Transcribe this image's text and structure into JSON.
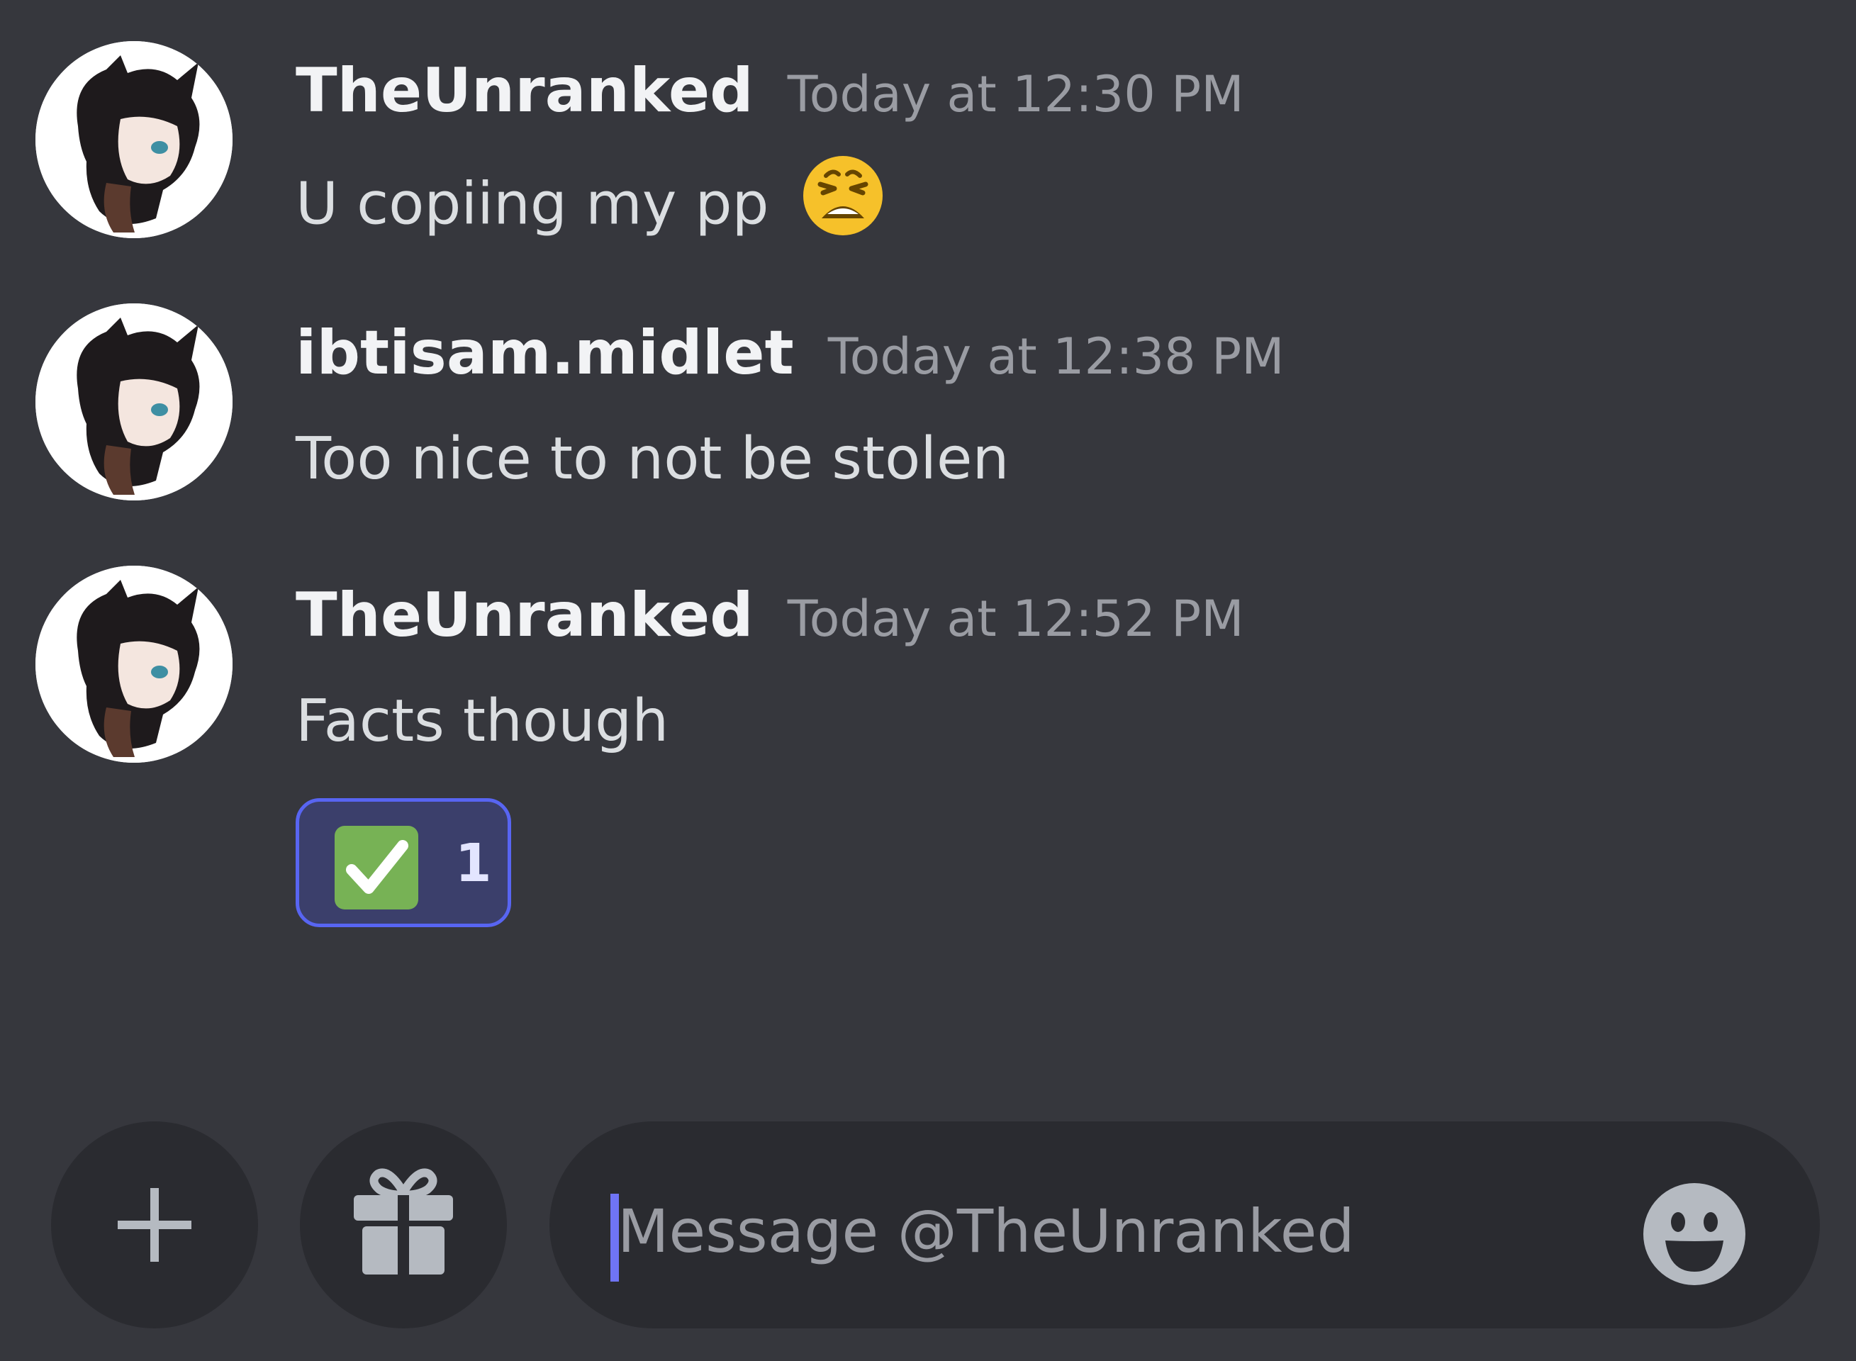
{
  "messages": [
    {
      "author": "TheUnranked",
      "timestamp": "Today at 12:30 PM",
      "text": "U copiing my pp",
      "emoji": "weary-face"
    },
    {
      "author": "ibtisam.midlet",
      "timestamp": "Today at 12:38 PM",
      "text": "Too nice to not be stolen"
    },
    {
      "author": "TheUnranked",
      "timestamp": "Today at 12:52 PM",
      "text": "Facts though",
      "reaction": {
        "emoji": "check-mark-button",
        "count": "1"
      }
    }
  ],
  "composer": {
    "placeholder": "Message @TheUnranked",
    "attach_icon": "plus-icon",
    "gift_icon": "gift-icon",
    "emoji_icon": "smiley-icon"
  },
  "colors": {
    "background": "#36373d",
    "input_background": "#2a2b30",
    "reaction_border": "#5865f2",
    "reaction_background": "#3b3f6b",
    "caret": "#6f74f5"
  }
}
